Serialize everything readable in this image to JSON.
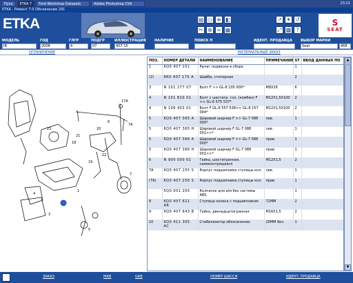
{
  "taskbar": {
    "items": [
      "Пуск",
      "ETKA 7",
      "Ford Workshop Datasets",
      "Adobe Photoshop CS4"
    ],
    "clock": "23:21"
  },
  "window": {
    "title": "ETKA - Ремонт 7.0 Обновление 291"
  },
  "app": {
    "logo": "ETKA",
    "brand": "SEAT",
    "brand_mark": "S"
  },
  "filters": {
    "labels": {
      "model": "МОДЕЛЬ",
      "year": "ГОД",
      "gg": "ГЛГР",
      "podgr": "ПОДГР",
      "illustration": "ИЛЛЮСТРАЦИЯ",
      "note": "НАЛИЧИЕ",
      "search": "ПОИСК П",
      "ident": "ИДЕНТ. ПРОДАВЦА",
      "brand_select": "ВЫБОР МАРКИ"
    },
    "values": {
      "model": "IB",
      "year": "2008",
      "gg": "4",
      "podgr": "07",
      "illustration": "407-15",
      "note": "",
      "search": "",
      "ident": "",
      "brand_select": "Seat",
      "brand_num": "468"
    }
  },
  "tabs": {
    "restriction": "ОГРАНИЧЕНИЕ",
    "order": "МАТЕРИАЛЬНЫЙ ЗАКАЗ"
  },
  "table": {
    "headers": [
      "ПОЗ.",
      "НОМЕР ДЕТАЛИ",
      "НАИМЕНОВАНИЕ",
      "ПРИМЕЧАНИЕ",
      "ST",
      "ВВОД ДАННЫХ ПО"
    ],
    "rows": [
      {
        "pos": "1",
        "pn": "6Q0 407 151",
        "name": "Рычаг подвески в сборе",
        "note": "",
        "st": "1"
      },
      {
        "pos": "(2)",
        "pn": "6R0 407 175 A",
        "name": "Шайба, стопорная",
        "note": "",
        "st": "2"
      },
      {
        "pos": "3",
        "pn": "N 101 277 07",
        "name": "Болт F >> GL-8 105 000*",
        "note": "M8X26",
        "st": "6"
      },
      {
        "pos": "4",
        "pn": "N 101 810 01",
        "name": "Болт с шестигр. гол. (комбин) F >> GL-6 575 537*",
        "note": "M12X1,5X100",
        "st": "2"
      },
      {
        "pos": "4",
        "pn": "N 106 403 01",
        "name": "Болт F GL-6 557 538>> GL-8 157 004*",
        "note": "M12X1,5X100",
        "st": "2"
      },
      {
        "pos": "5",
        "pn": "6Q0 407 365 A",
        "name": "Шаровой шарнир F >> GL-7 088 000*",
        "note": "лев.",
        "st": "1"
      },
      {
        "pos": "5",
        "pn": "6Q0 407 365 H",
        "name": "Шаровой шарнир F GL-7 088 001>>*",
        "note": "лев.",
        "st": "1"
      },
      {
        "pos": "5",
        "pn": "6Q0 407 366 A",
        "name": "Шаровой шарнир F >> GL-7 088 000*",
        "note": "прав.",
        "st": "1"
      },
      {
        "pos": "5",
        "pn": "6Q0 407 366 H",
        "name": "Шаровой шарнир F GL-7 088 001>>*",
        "note": "прав.",
        "st": "1"
      },
      {
        "pos": "6",
        "pn": "N 900 000 01",
        "name": "Гайка, шестигранная, самоконтрящаяся",
        "note": "M12X1,5",
        "st": "2"
      },
      {
        "pos": "7A",
        "pn": "6Q0 407 255 S",
        "name": "Корпус подшипника ступицы кол.",
        "note": "лев.",
        "st": "1"
      },
      {
        "pos": "(7A)",
        "pn": "6Q0 407 256 S",
        "name": "Корпус подшипника ступицы кол.",
        "note": "прав.",
        "st": "1"
      },
      {
        "pos": "",
        "pn": "5Q0 001 205",
        "name": "Колпачок для а/м без системы ABS",
        "note": "",
        "st": "1"
      },
      {
        "pos": "8",
        "pn": "6Q0 407 621 AR",
        "name": "Ступица колеса с подшипником",
        "note": "72MM",
        "st": "2"
      },
      {
        "pos": "9",
        "pn": "6Q0 407 643 B",
        "name": "Гайка, двенадцатигранная",
        "note": "M16X1,5",
        "st": "2"
      },
      {
        "pos": "10",
        "pn": "6Q0 411 305 AC",
        "name": "Стабилизатор обозначение:",
        "note": "20MM без.",
        "st": "1"
      }
    ]
  },
  "diagram": {
    "callouts": [
      "17A",
      "7A",
      "6",
      "20",
      "21",
      "22",
      "19",
      "18",
      "23",
      "1",
      "4",
      "3",
      "5",
      "7"
    ]
  },
  "bottombar": {
    "links": [
      "ЗАКАЗ",
      "МКВ",
      "GKB",
      "НОМЕР ШАССИ",
      "ИДЕНТ. ПРОДАВЦА"
    ]
  },
  "colors": {
    "header_bg": "#1f4f9c",
    "brand_red": "#c8102e",
    "row_band": "#dde4f1"
  }
}
